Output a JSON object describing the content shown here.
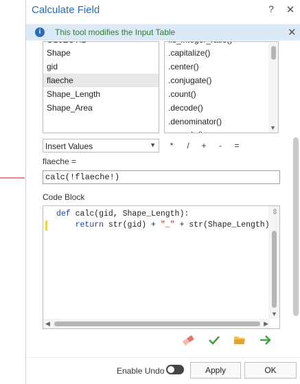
{
  "window": {
    "title": "Calculate Field",
    "help_glyph": "?",
    "close_glyph": "✕"
  },
  "info_bar": {
    "icon_glyph": "i",
    "message": "This tool modifies the Input Table",
    "close_glyph": "✕"
  },
  "fields_list": {
    "partial_item": "OBJECTID",
    "items": [
      "Shape",
      "gid",
      "flaeche",
      "Shape_Length",
      "Shape_Area"
    ],
    "selected": "flaeche"
  },
  "methods_list": {
    "partial_top": ".is_integer_ratio()",
    "items": [
      ".capitalize()",
      ".center()",
      ".conjugate()",
      ".count()",
      ".decode()",
      ".denominator()"
    ],
    "partial_bottom": ".encode()"
  },
  "helper_type_select": {
    "value": "Insert Values"
  },
  "operators": [
    "*",
    "/",
    "+",
    "-",
    "="
  ],
  "expression": {
    "label": "flaeche =",
    "value": "calc(!flaeche!)"
  },
  "code_block": {
    "label": "Code Block",
    "line1_kw": "def",
    "line1_rest": " calc(gid, Shape_Length):",
    "line2_indent": "    ",
    "line2_kw": "return",
    "line2_a": " str(gid) + ",
    "line2_str": "\"_\"",
    "line2_b": " + str(Shape_Length)"
  },
  "toolbar_icons": [
    "eraser-icon",
    "verify-check-icon",
    "open-folder-icon",
    "export-arrow-icon"
  ],
  "footer": {
    "enable_undo_label": "Enable Undo",
    "enable_undo": false,
    "apply_label": "Apply",
    "ok_label": "OK"
  },
  "colors": {
    "title_blue": "#2a6ab8",
    "info_bg": "#dce9f6",
    "info_text_green": "#2e7d32",
    "annotation_red": "#e53935",
    "keyword_blue": "#1a3fb0",
    "string_red": "#c62828"
  }
}
